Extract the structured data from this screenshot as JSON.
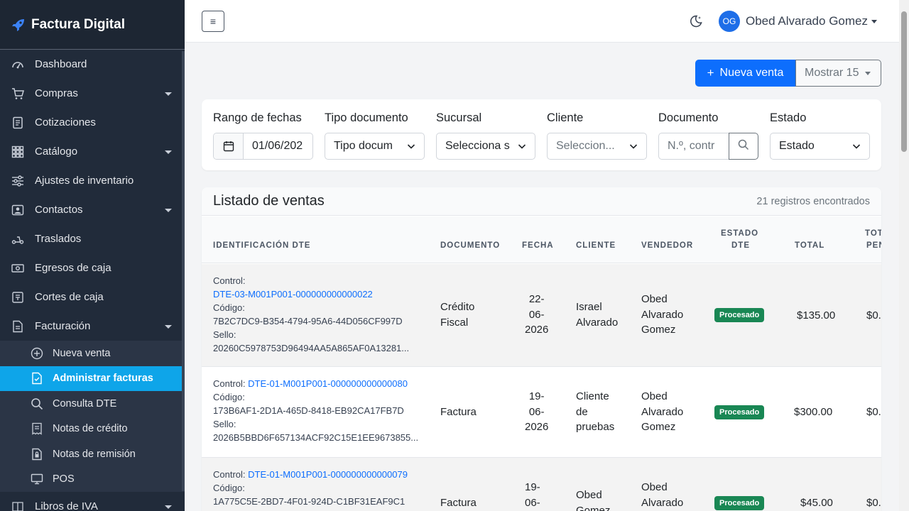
{
  "brand": {
    "title": "Factura Digital"
  },
  "sidebar": {
    "items": [
      {
        "label": "Dashboard",
        "icon": "gauge-icon"
      },
      {
        "label": "Compras",
        "icon": "cart-icon",
        "caret": true
      },
      {
        "label": "Cotizaciones",
        "icon": "document-icon"
      },
      {
        "label": "Catálogo",
        "icon": "grid-icon",
        "caret": true
      },
      {
        "label": "Ajustes de inventario",
        "icon": "sliders-icon"
      },
      {
        "label": "Contactos",
        "icon": "contact-icon",
        "caret": true
      },
      {
        "label": "Traslados",
        "icon": "scooter-icon"
      },
      {
        "label": "Egresos de caja",
        "icon": "cash-icon"
      },
      {
        "label": "Cortes de caja",
        "icon": "register-icon"
      },
      {
        "label": "Facturación",
        "icon": "invoice-icon",
        "caret": true
      }
    ],
    "subitems": [
      {
        "label": "Nueva venta",
        "icon": "plus-circle-icon"
      },
      {
        "label": "Administrar facturas",
        "icon": "file-check-icon",
        "active": true
      },
      {
        "label": "Consulta DTE",
        "icon": "search-icon"
      },
      {
        "label": "Notas de crédito",
        "icon": "receipt-icon"
      },
      {
        "label": "Notas de remisión",
        "icon": "file-lock-icon"
      },
      {
        "label": "POS",
        "icon": "monitor-icon"
      }
    ],
    "last_item": {
      "label": "Libros de IVA",
      "icon": "book-icon"
    }
  },
  "topbar": {
    "menu_icon": "≡",
    "user_initials": "OG",
    "user_name": "Obed Alvarado Gomez"
  },
  "actions": {
    "new_sale": "Nueva venta",
    "show": "Mostrar 15"
  },
  "filters": {
    "date_label": "Rango de fechas",
    "date_value": "01/06/202",
    "doc_type_label": "Tipo documento",
    "doc_type_value": "Tipo docum",
    "branch_label": "Sucursal",
    "branch_value": "Selecciona s",
    "client_label": "Cliente",
    "client_value": "Seleccion...",
    "document_label": "Documento",
    "document_placeholder": "N.º, contr",
    "status_label": "Estado",
    "status_value": "Estado"
  },
  "table": {
    "title": "Listado de ventas",
    "count": "21 registros encontrados",
    "headers": {
      "dte_id": "IDENTIFICACIÓN DTE",
      "document": "DOCUMENTO",
      "date": "FECHA",
      "client": "CLIENTE",
      "seller": "VENDEDOR",
      "status_line1": "ESTADO",
      "status_line2": "DTE",
      "total": "TOTAL",
      "pending_line1": "TOT",
      "pending_line2": "PEN"
    },
    "labels": {
      "control": "Control:",
      "code": "Código:",
      "seal": "Sello:"
    },
    "rows": [
      {
        "control": "DTE-03-M001P001-000000000000022",
        "code": "7B2C7DC9-B354-4794-95A6-44D056CF997D",
        "seal": "20260C5978753D96494AA5A865AF0A13281...",
        "doc_line1": "Crédito",
        "doc_line2": "Fiscal",
        "date1": "22-",
        "date2": "06-",
        "date3": "2026",
        "client1": "Israel",
        "client2": "Alvarado",
        "client3": "",
        "seller1": "Obed",
        "seller2": "Alvarado",
        "seller3": "Gomez",
        "status": "Procesado",
        "total": "$135.00",
        "pending": "$0."
      },
      {
        "control": "DTE-01-M001P001-000000000000080",
        "code": "173B6AF1-2D1A-465D-8418-EB92CA17FB7D",
        "seal": "2026B5BBD6F657134ACF92C15E1EE9673855...",
        "doc_line1": "Factura",
        "doc_line2": "",
        "date1": "19-",
        "date2": "06-",
        "date3": "2026",
        "client1": "Cliente",
        "client2": "de",
        "client3": "pruebas",
        "seller1": "Obed",
        "seller2": "Alvarado",
        "seller3": "Gomez",
        "status": "Procesado",
        "total": "$300.00",
        "pending": "$0."
      },
      {
        "control": "DTE-01-M001P001-000000000000079",
        "code": "1A775C5E-2BD7-4F01-924D-C1BF31EAF9C1",
        "seal": "",
        "doc_line1": "Factura",
        "doc_line2": "",
        "date1": "19-",
        "date2": "06-",
        "date3": "",
        "client1": "Obed",
        "client2": "Gomez",
        "client3": "",
        "seller1": "Obed",
        "seller2": "Alvarado",
        "seller3": "",
        "status": "Procesado",
        "total": "$45.00",
        "pending": "$0."
      }
    ]
  },
  "colors": {
    "primary": "#0d6efd",
    "success": "#198754",
    "active_nav": "#0ea5e9",
    "sidebar_bg": "#212b3a"
  }
}
